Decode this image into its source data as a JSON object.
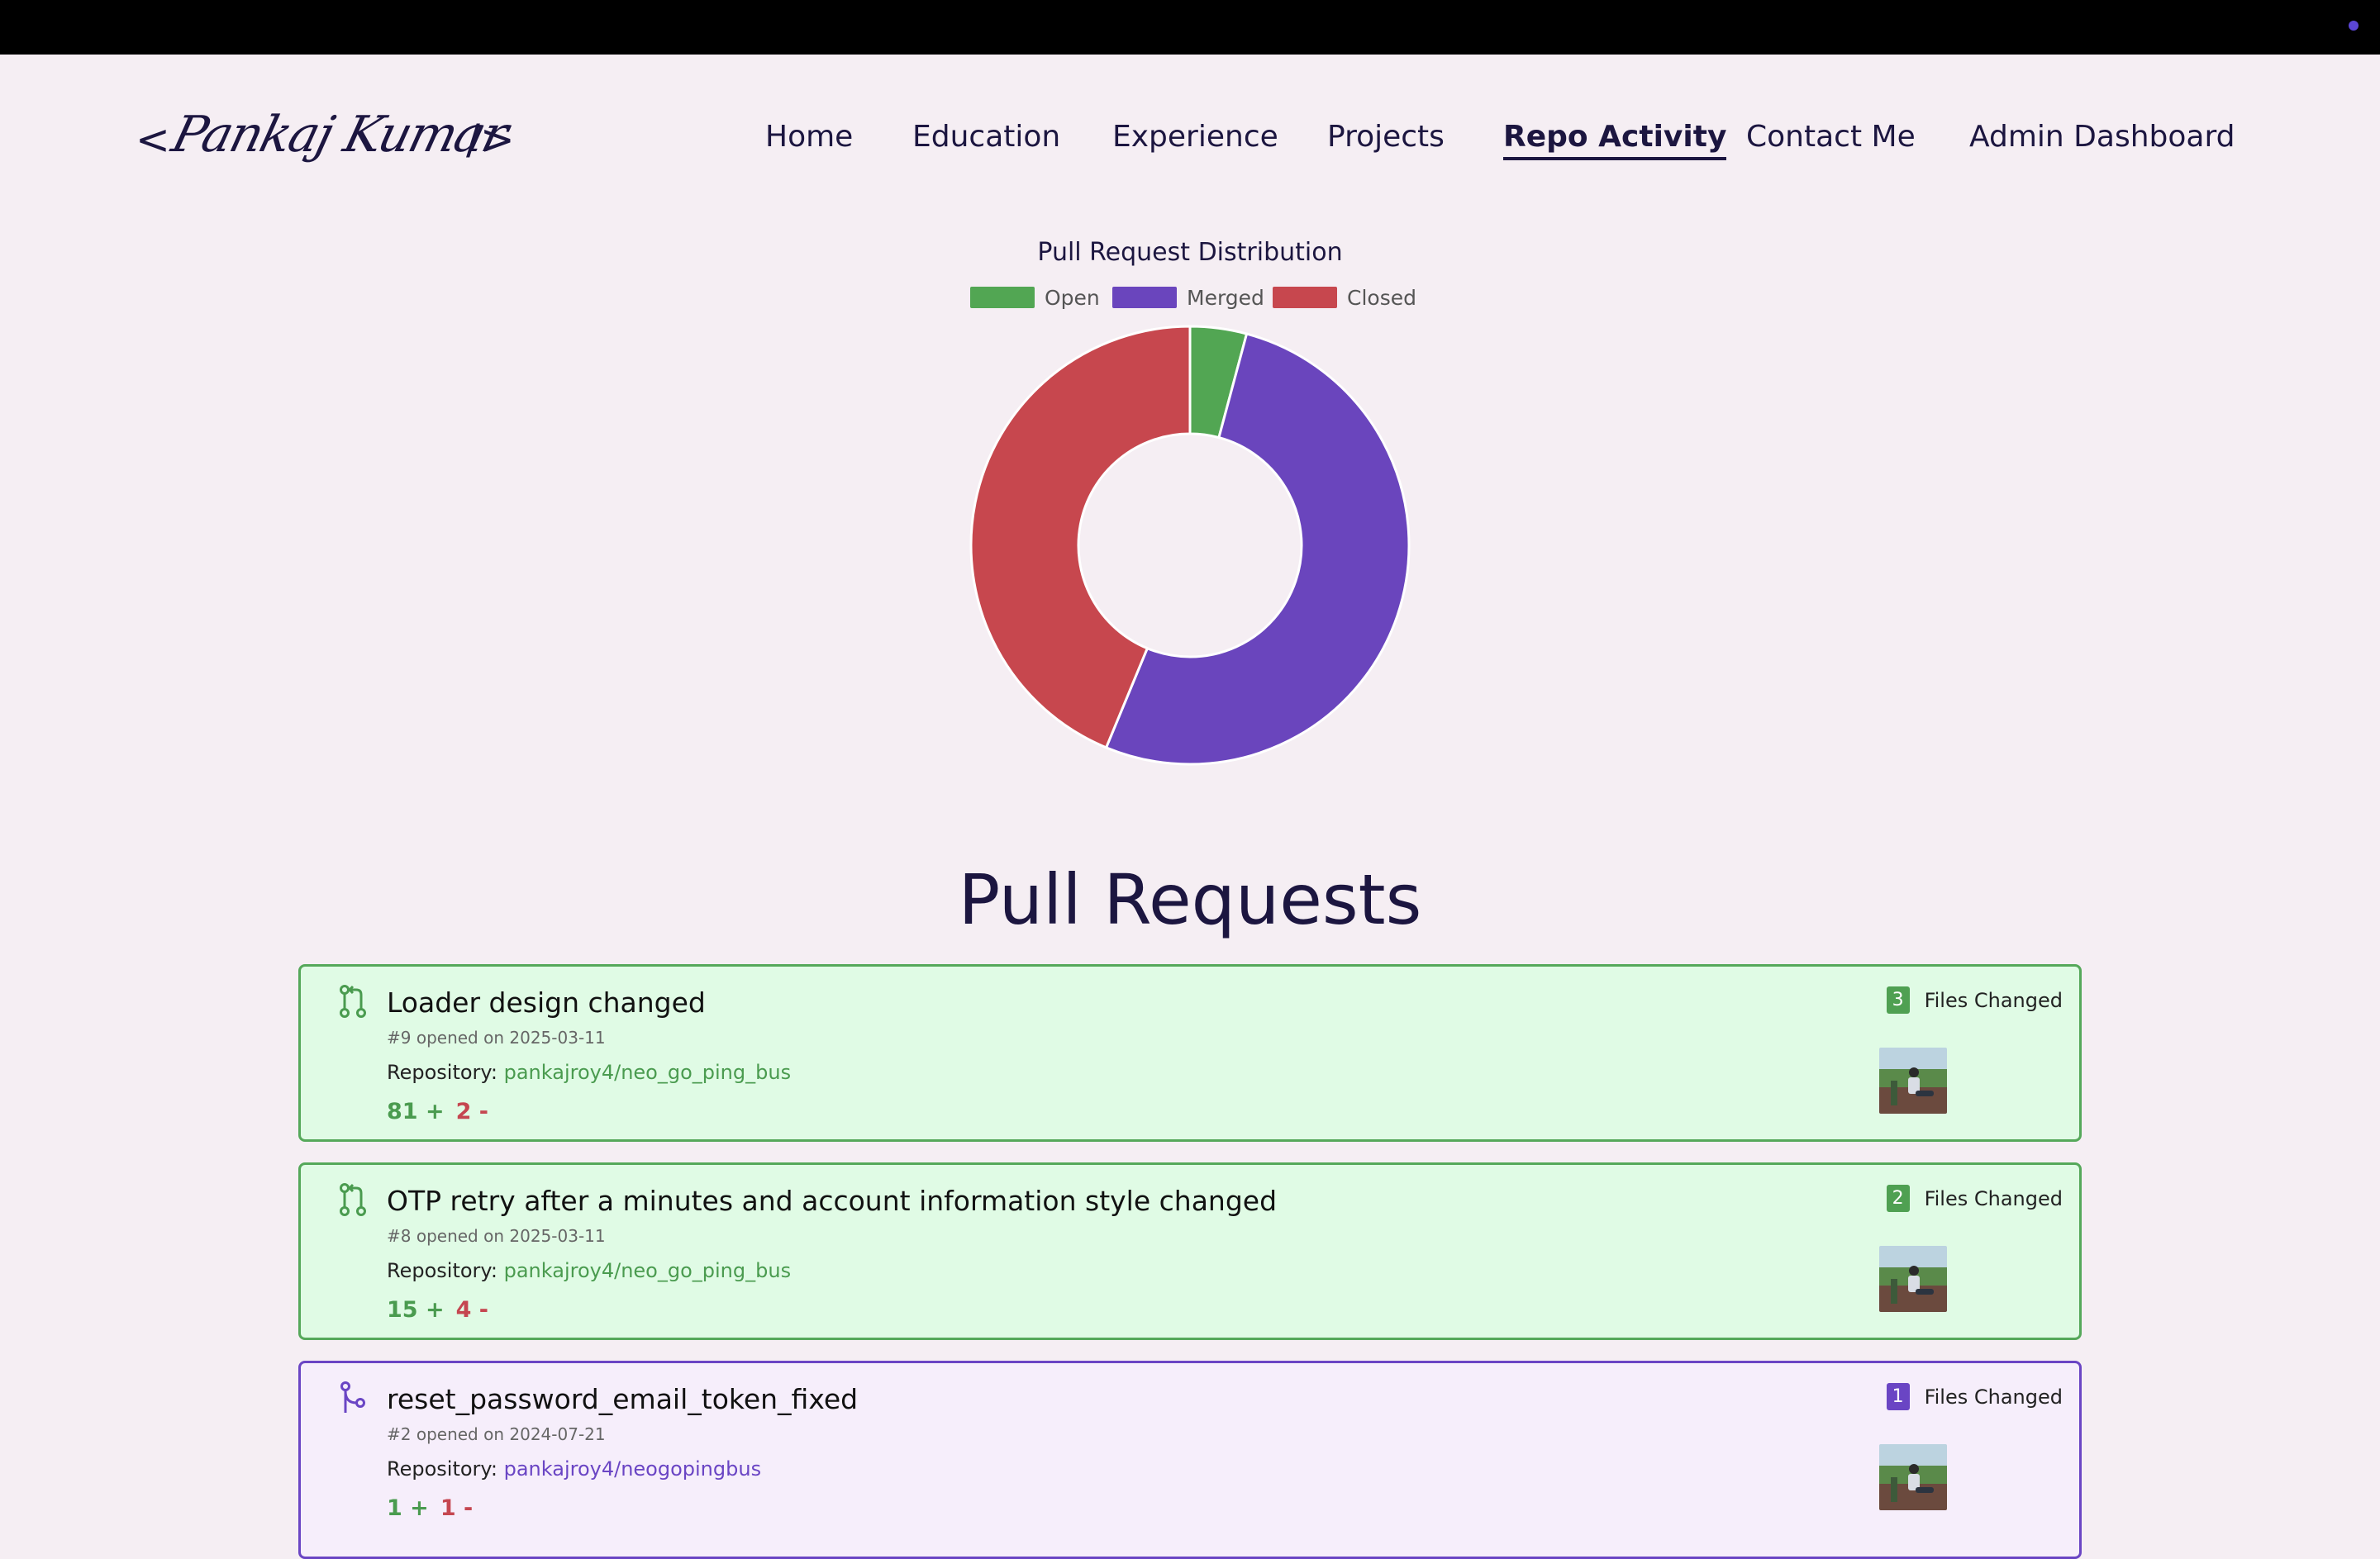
{
  "logo": {
    "left": "<",
    "signature": "Pankaj Kumar",
    "right": "/>"
  },
  "nav": {
    "items": [
      {
        "label": "Home"
      },
      {
        "label": "Education"
      },
      {
        "label": "Experience"
      },
      {
        "label": "Projects"
      },
      {
        "label": "Repo Activity",
        "active": true
      },
      {
        "label": "Contact Me"
      },
      {
        "label": "Admin Dashboard"
      }
    ]
  },
  "chart_data": {
    "type": "pie",
    "style": "doughnut",
    "title": "Pull Request Distribution",
    "categories": [
      "Open",
      "Merged",
      "Closed"
    ],
    "values": [
      2,
      25,
      21
    ],
    "colors": [
      "#52a653",
      "#6a45bd",
      "#c7474e"
    ],
    "legend_position": "top"
  },
  "section": {
    "heading": "Pull Requests"
  },
  "pull_requests": [
    {
      "status": "open",
      "title": "Loader design changed",
      "meta": "#9 opened on 2025-03-11",
      "repo_label": "Repository:",
      "repo": "pankajroy4/neo_go_ping_bus",
      "additions": "81 +",
      "deletions": "2 -",
      "files_count": "3",
      "files_label": "Files Changed"
    },
    {
      "status": "open",
      "title": "OTP retry after a minutes and account information style changed",
      "meta": "#8 opened on 2025-03-11",
      "repo_label": "Repository:",
      "repo": "pankajroy4/neo_go_ping_bus",
      "additions": "15 +",
      "deletions": "4 -",
      "files_count": "2",
      "files_label": "Files Changed"
    },
    {
      "status": "merged",
      "title": "reset_password_email_token_fixed",
      "meta": "#2 opened on 2024-07-21",
      "repo_label": "Repository:",
      "repo": "pankajroy4/neogopingbus",
      "additions": "1 +",
      "deletions": "1 -",
      "files_count": "1",
      "files_label": "Files Changed"
    }
  ]
}
